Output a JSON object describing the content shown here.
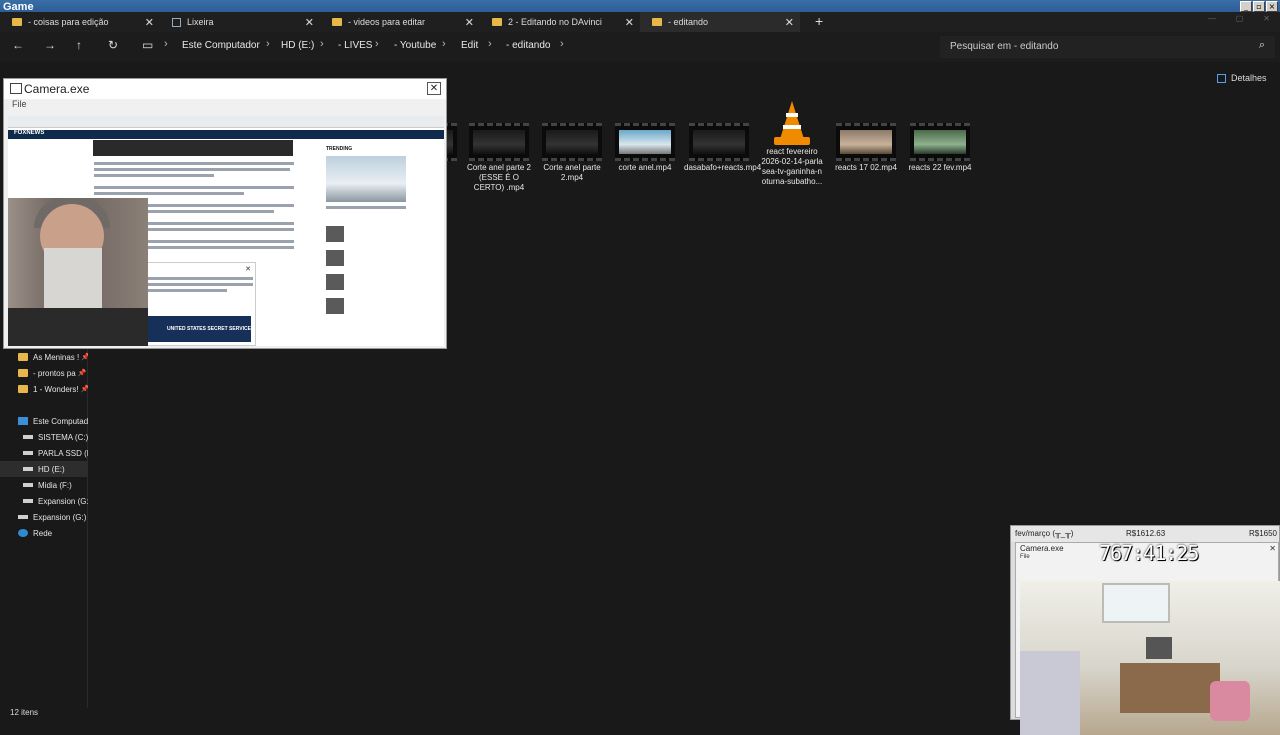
{
  "window": {
    "title": "Game"
  },
  "tabs": [
    {
      "label": "- coisas para edição",
      "icon": "folder-icon"
    },
    {
      "label": "Lixeira",
      "icon": "camera-icon"
    },
    {
      "label": "- videos para editar",
      "icon": "folder-icon"
    },
    {
      "label": "2 - Editando no DAvinci",
      "icon": "folder-icon"
    },
    {
      "label": "- editando",
      "icon": "folder-icon"
    }
  ],
  "breadcrumb": [
    "Este Computador",
    "HD (E:)",
    "- LIVES",
    "- Youtube",
    "Edit",
    "- editando"
  ],
  "search": {
    "placeholder": "Pesquisar em - editando"
  },
  "toolbar": {
    "details_label": "Detalhes"
  },
  "sidebar": [
    {
      "label": "As Meninas !",
      "icon": "folder-icon",
      "pinned": true
    },
    {
      "label": "- prontos pa",
      "icon": "folder-icon",
      "pinned": true
    },
    {
      "label": "1 - Wonders!",
      "icon": "folder-icon",
      "pinned": true
    },
    {
      "label": "Este Computad",
      "icon": "computer-icon"
    },
    {
      "label": "SISTEMA (C:)",
      "icon": "drive-icon"
    },
    {
      "label": "PARLA SSD (D",
      "icon": "drive-icon"
    },
    {
      "label": "HD (E:)",
      "icon": "drive-icon",
      "selected": true
    },
    {
      "label": "Midia (F:)",
      "icon": "drive-icon"
    },
    {
      "label": "Expansion (G:)",
      "icon": "drive-icon"
    },
    {
      "label": "Expansion (G:)",
      "icon": "drive-icon"
    },
    {
      "label": "Rede",
      "icon": "network-icon"
    }
  ],
  "files": [
    {
      "name": "Corte anel parte 2 (ESSE É O CERTO) .mp4",
      "thumb": "dark"
    },
    {
      "name": "Corte anel parte 2.mp4",
      "thumb": "dark"
    },
    {
      "name": "corte anel.mp4",
      "thumb": "light"
    },
    {
      "name": "dasabafo+reacts.mp4",
      "thumb": "dark"
    },
    {
      "name": "react fevereiro 2026-02-14-parla sea-tv-ganinha-n oturna-subatho...",
      "thumb": "vlc"
    },
    {
      "name": "reacts 17 02.mp4",
      "thumb": "people"
    },
    {
      "name": "reacts 22 fev.mp4",
      "thumb": "green"
    }
  ],
  "status": {
    "count": "12 itens"
  },
  "camera_window": {
    "title": "Camera.exe",
    "menu": "File",
    "article": {
      "site": "FOXNEWS",
      "trending": "TRENDING",
      "banner": "UNITED STATES SECRET SERVICE"
    }
  },
  "stream_overlay": {
    "label_left": "fev/março (╥_╥)",
    "label_mid": "R$1612.63",
    "label_right": "R$1650",
    "cam_title": "Camera.exe",
    "cam_menu": "File",
    "timer": "767:41:25"
  }
}
